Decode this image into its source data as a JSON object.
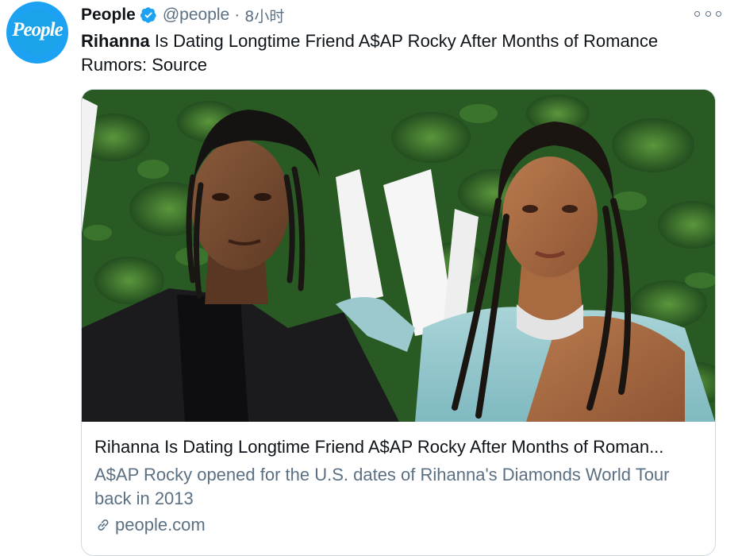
{
  "tweet": {
    "author_name": "People",
    "handle": "@people",
    "separator": "·",
    "time": "8小时",
    "avatar_text": "People",
    "text_bold": "Rihanna",
    "text_rest": " Is Dating Longtime Friend A$AP Rocky After Months of Romance Rumors: Source"
  },
  "card": {
    "title": "Rihanna Is Dating Longtime Friend A$AP Rocky After Months of Roman...",
    "description": "A$AP Rocky opened for the U.S. dates of Rihanna's Diamonds World Tour back in 2013",
    "domain": "people.com",
    "image_subject": "photo of two people in front of a green foliage backdrop"
  },
  "icons": {
    "verified": "verified-badge-icon",
    "more": "more-options-icon",
    "link": "link-icon"
  },
  "colors": {
    "accent": "#1da1f2",
    "secondary_text": "#5b7083",
    "border": "#cfd9de"
  }
}
